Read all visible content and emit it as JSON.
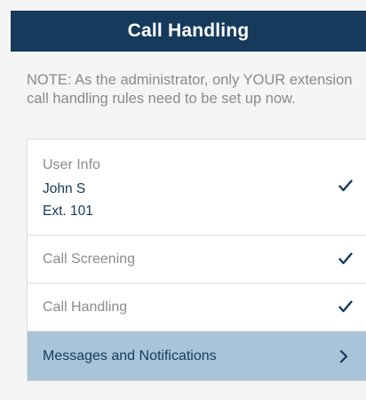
{
  "header": {
    "title": "Call Handling"
  },
  "note": {
    "text": "NOTE: As the administrator, only YOUR extension call handling rules need to be set up now."
  },
  "rules": {
    "user_info": {
      "label": "User Info",
      "name": "John S",
      "ext": "Ext. 101",
      "status_icon": "checkmark-icon"
    },
    "call_screening": {
      "label": "Call Screening",
      "status_icon": "checkmark-icon"
    },
    "call_handling": {
      "label": "Call Handling",
      "status_icon": "checkmark-icon"
    },
    "messages": {
      "label": "Messages and Notifications",
      "status_icon": "chevron-right-icon"
    }
  },
  "colors": {
    "header_background": "#153a5b",
    "accent": "#153a5b",
    "selected_row": "#a7c4d9",
    "muted_text": "#8c8c8c"
  }
}
